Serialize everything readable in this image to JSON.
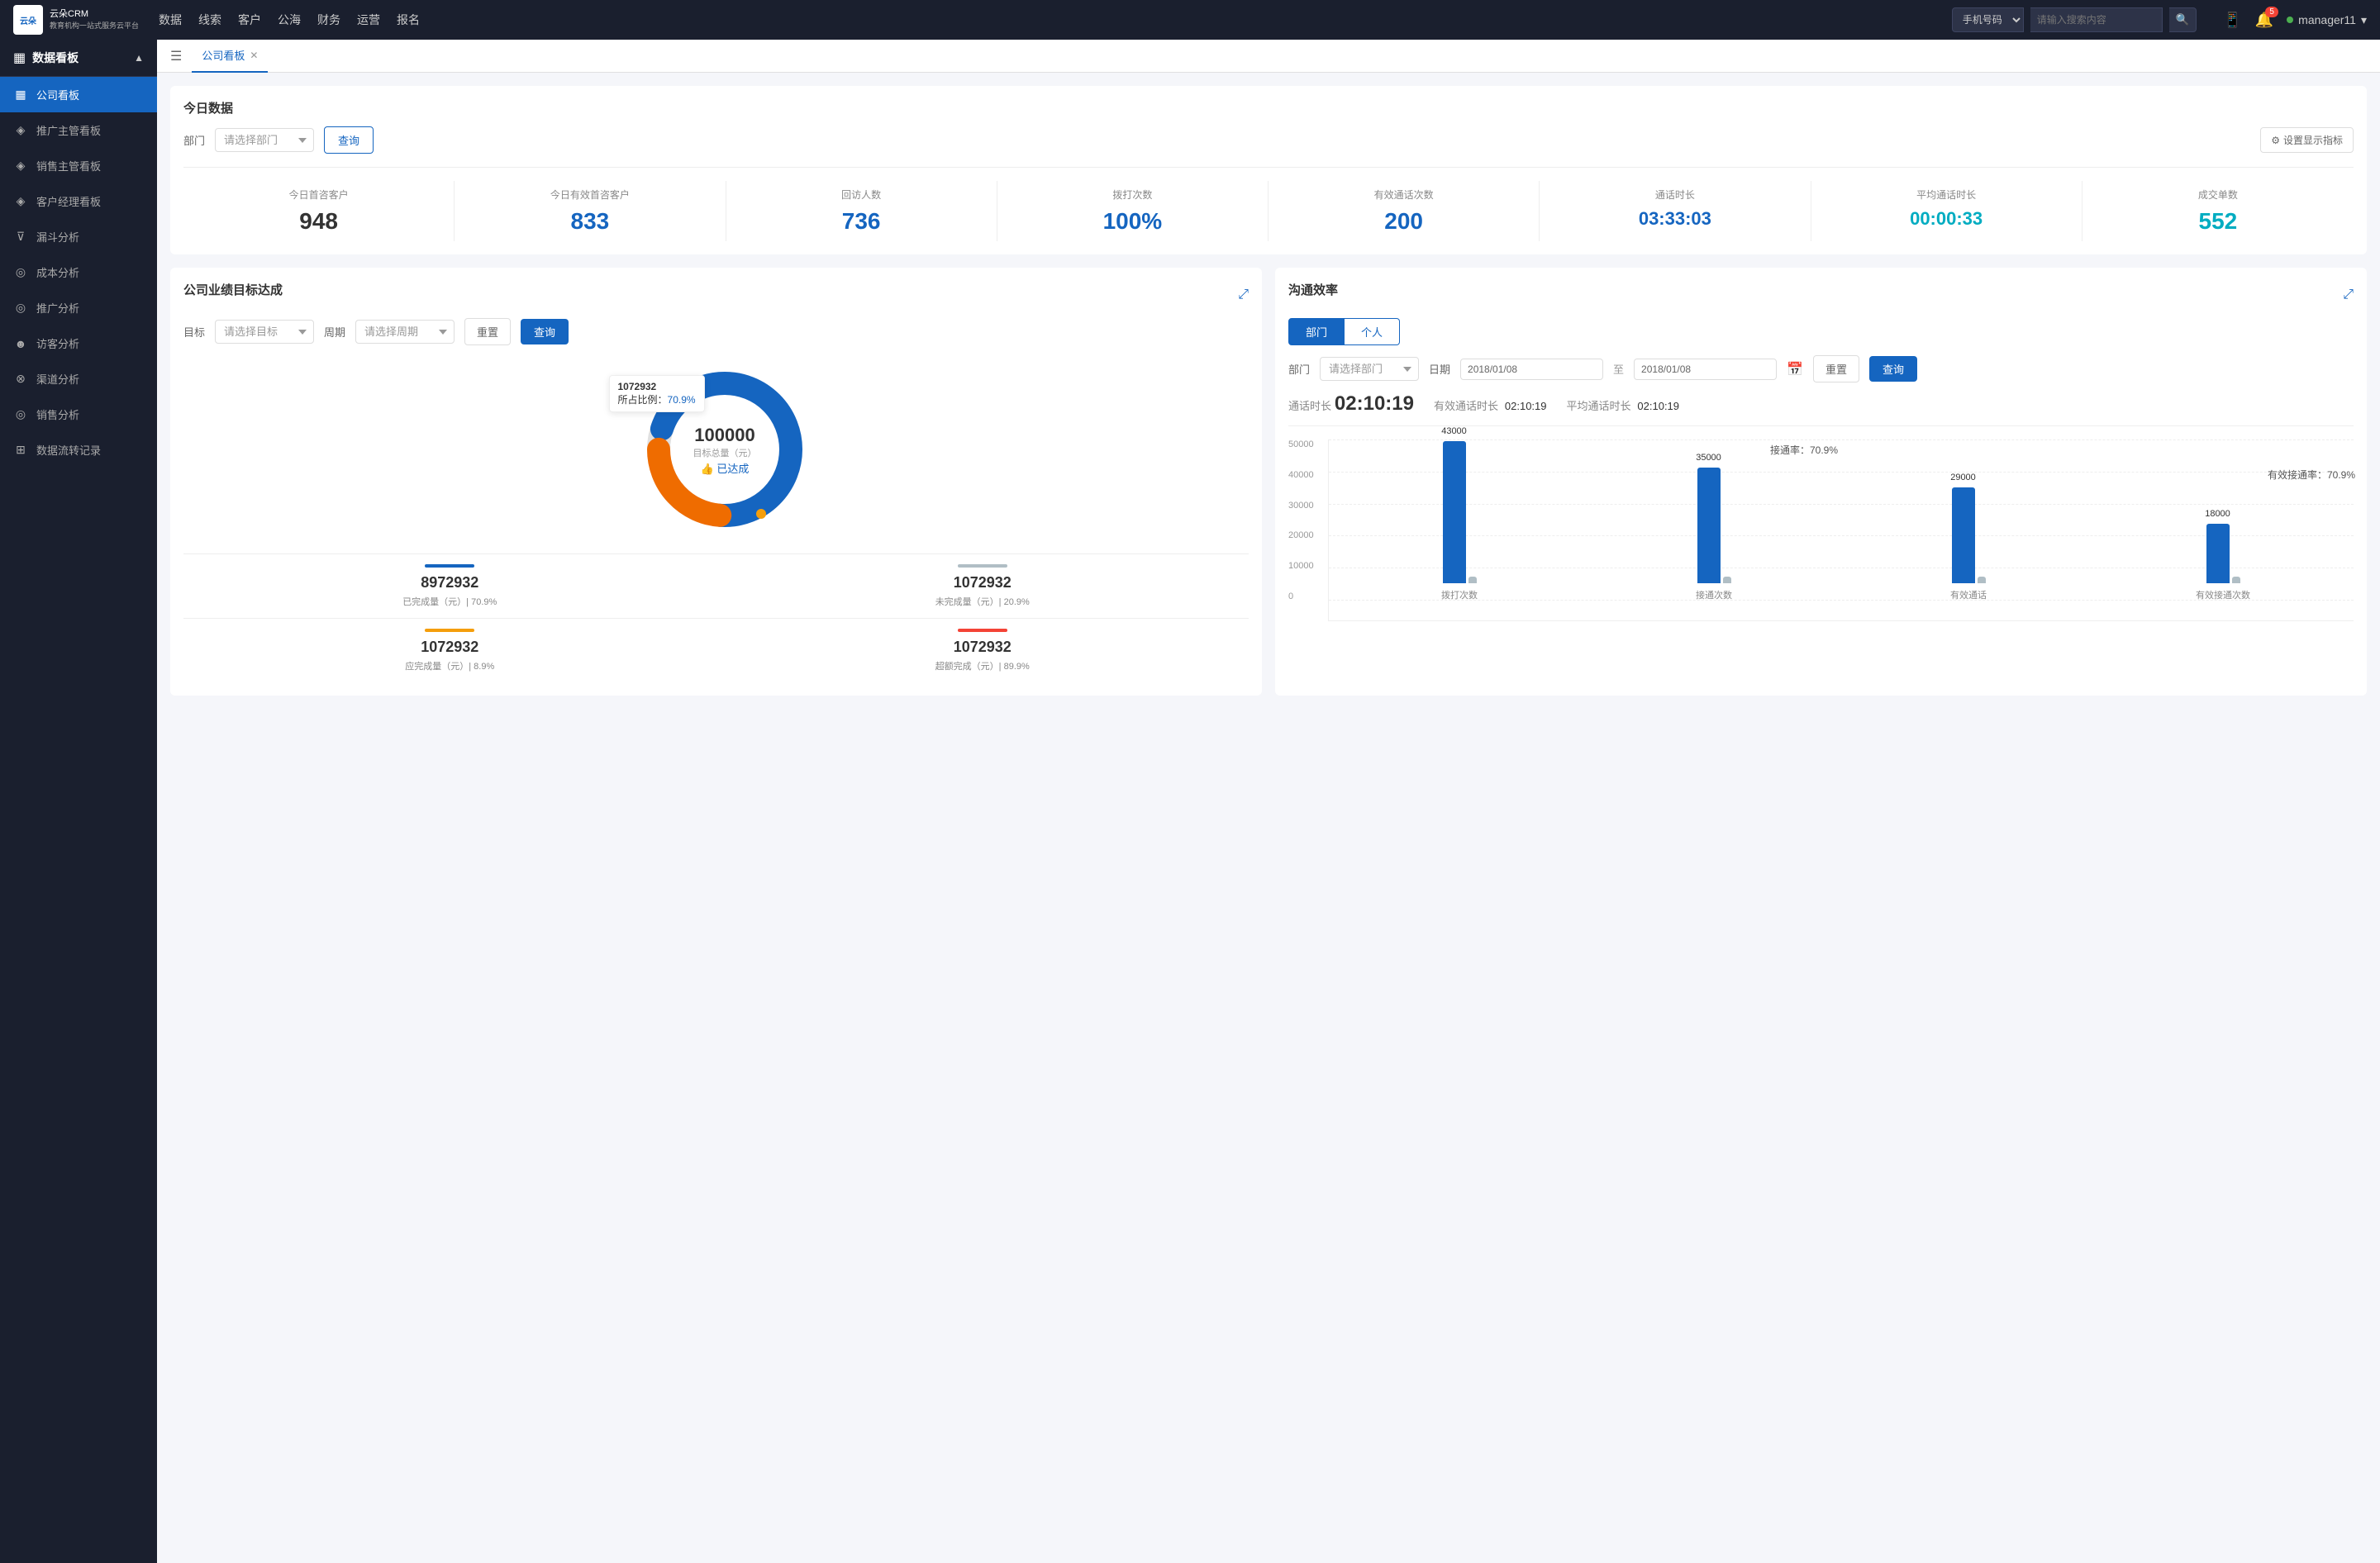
{
  "topNav": {
    "logo": {
      "line1": "云朵CRM",
      "line2": "教育机构一站\n式服务云平台"
    },
    "navItems": [
      "数据",
      "线索",
      "客户",
      "公海",
      "财务",
      "运营",
      "报名"
    ],
    "search": {
      "dropdown": "手机号码",
      "placeholder": "请输入搜索内容"
    },
    "notificationCount": "5",
    "username": "manager11"
  },
  "sidebar": {
    "title": "数据看板",
    "items": [
      {
        "label": "公司看板",
        "icon": "▦",
        "active": true
      },
      {
        "label": "推广主管看板",
        "icon": "◈"
      },
      {
        "label": "销售主管看板",
        "icon": "◈"
      },
      {
        "label": "客户经理看板",
        "icon": "◈"
      },
      {
        "label": "漏斗分析",
        "icon": "⊽"
      },
      {
        "label": "成本分析",
        "icon": "◎"
      },
      {
        "label": "推广分析",
        "icon": "◎"
      },
      {
        "label": "访客分析",
        "icon": "☻"
      },
      {
        "label": "渠道分析",
        "icon": "⊗"
      },
      {
        "label": "销售分析",
        "icon": "◎"
      },
      {
        "label": "数据流转记录",
        "icon": "⊞"
      }
    ]
  },
  "tab": {
    "label": "公司看板"
  },
  "todayData": {
    "sectionTitle": "今日数据",
    "filterLabel": "部门",
    "filterPlaceholder": "请选择部门",
    "queryBtn": "查询",
    "settingsBtn": "设置显示指标",
    "stats": [
      {
        "label": "今日首咨客户",
        "value": "948",
        "color": "black"
      },
      {
        "label": "今日有效首咨客户",
        "value": "833",
        "color": "blue"
      },
      {
        "label": "回访人数",
        "value": "736",
        "color": "blue"
      },
      {
        "label": "拨打次数",
        "value": "100%",
        "color": "blue"
      },
      {
        "label": "有效通话次数",
        "value": "200",
        "color": "blue"
      },
      {
        "label": "通话时长",
        "value": "03:33:03",
        "color": "blue"
      },
      {
        "label": "平均通话时长",
        "value": "00:00:33",
        "color": "cyan"
      },
      {
        "label": "成交单数",
        "value": "552",
        "color": "cyan"
      }
    ]
  },
  "goalCard": {
    "title": "公司业绩目标达成",
    "goalLabel": "目标",
    "goalPlaceholder": "请选择目标",
    "periodLabel": "周期",
    "periodPlaceholder": "请选择周期",
    "resetBtn": "重置",
    "queryBtn": "查询",
    "donut": {
      "tooltip": {
        "num": "1072932",
        "pctLabel": "所占比例：",
        "pct": "70.9%"
      },
      "centerNum": "100000",
      "centerLabel": "目标总量（元）",
      "achievedLabel": "👍 已达成",
      "dot": {
        "color": "#f59e0b"
      }
    },
    "stats": [
      {
        "num": "8972932",
        "desc": "已完成量（元）| 70.9%",
        "barColor": "#1565c0",
        "barWidth": "60px"
      },
      {
        "num": "1072932",
        "desc": "未完成量（元）| 20.9%",
        "barColor": "#b0bec5",
        "barWidth": "60px"
      },
      {
        "num": "1072932",
        "desc": "应完成量（元）| 8.9%",
        "barColor": "#f59e0b",
        "barWidth": "60px"
      },
      {
        "num": "1072932",
        "desc": "超额完成（元）| 89.9%",
        "barColor": "#f44336",
        "barWidth": "60px"
      }
    ]
  },
  "commCard": {
    "title": "沟通效率",
    "tabs": [
      "部门",
      "个人"
    ],
    "activeTab": 0,
    "deptLabel": "部门",
    "deptPlaceholder": "请选择部门",
    "dateLabel": "日期",
    "dateFrom": "2018/01/08",
    "dateTo": "2018/01/08",
    "resetBtn": "重置",
    "queryBtn": "查询",
    "stats": {
      "callDurationLabel": "通话时长",
      "callDuration": "02:10:19",
      "effectiveDurationLabel": "有效通话时长",
      "effectiveDuration": "02:10:19",
      "avgDurationLabel": "平均通话时长",
      "avgDuration": "02:10:19"
    },
    "chart": {
      "yLabels": [
        "50000",
        "40000",
        "30000",
        "20000",
        "10000",
        "0"
      ],
      "groups": [
        {
          "label": "拨打次数",
          "bars": [
            {
              "value": 43000,
              "label": "43000",
              "color": "#1565c0",
              "height": 172
            },
            {
              "value": 0,
              "label": "",
              "color": "#b0bec5",
              "height": 8
            }
          ]
        },
        {
          "label": "接通次数",
          "annotation": "接通率：70.9%",
          "bars": [
            {
              "value": 35000,
              "label": "35000",
              "color": "#1565c0",
              "height": 140
            },
            {
              "value": 0,
              "label": "",
              "color": "#b0bec5",
              "height": 8
            }
          ]
        },
        {
          "label": "有效通话",
          "bars": [
            {
              "value": 29000,
              "label": "29000",
              "color": "#1565c0",
              "height": 116
            },
            {
              "value": 0,
              "label": "",
              "color": "#b0bec5",
              "height": 8
            }
          ]
        },
        {
          "label": "有效接通次数",
          "annotation": "有效接通率：70.9%",
          "bars": [
            {
              "value": 18000,
              "label": "18000",
              "color": "#1565c0",
              "height": 72
            },
            {
              "value": 0,
              "label": "",
              "color": "#b0bec5",
              "height": 8
            }
          ]
        }
      ]
    }
  }
}
